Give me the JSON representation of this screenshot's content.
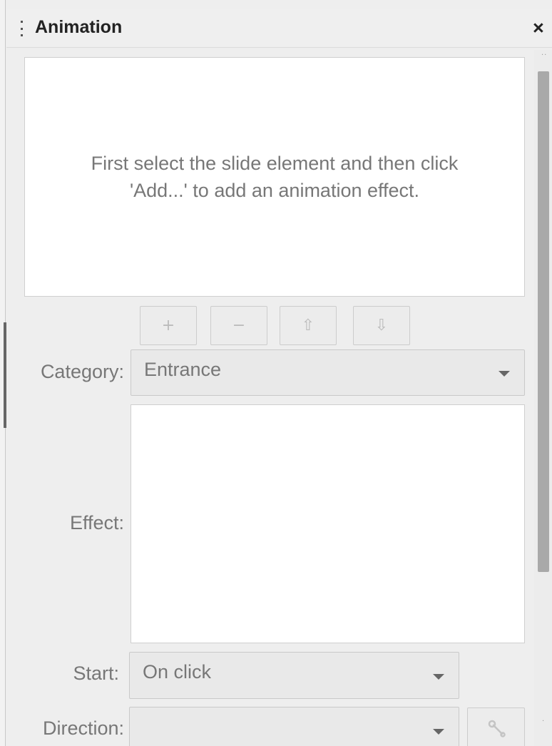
{
  "panel": {
    "title": "Animation",
    "close_label": "×"
  },
  "animation_list": {
    "hint_line1": "First select the slide element and then click",
    "hint_line2": "'Add...' to add an animation effect."
  },
  "buttons": {
    "add_label": "+",
    "remove_label": "−",
    "move_up_label": "⇧",
    "move_down_label": "⇩"
  },
  "form": {
    "category_label": "Category:",
    "category_value": "Entrance",
    "effect_label": "Effect:",
    "start_label": "Start:",
    "start_value": "On click",
    "direction_label": "Direction:",
    "direction_value": ""
  },
  "icons": {
    "options": "wrench-icon",
    "dropdown": "chevron-down-icon",
    "drag_handle": "drag-handle-icon"
  },
  "colors": {
    "panel_bg": "#eeeeee",
    "list_bg": "#ffffff",
    "disabled_text": "#777777",
    "title_text": "#222222",
    "scroll_thumb": "#a9a9a9"
  }
}
